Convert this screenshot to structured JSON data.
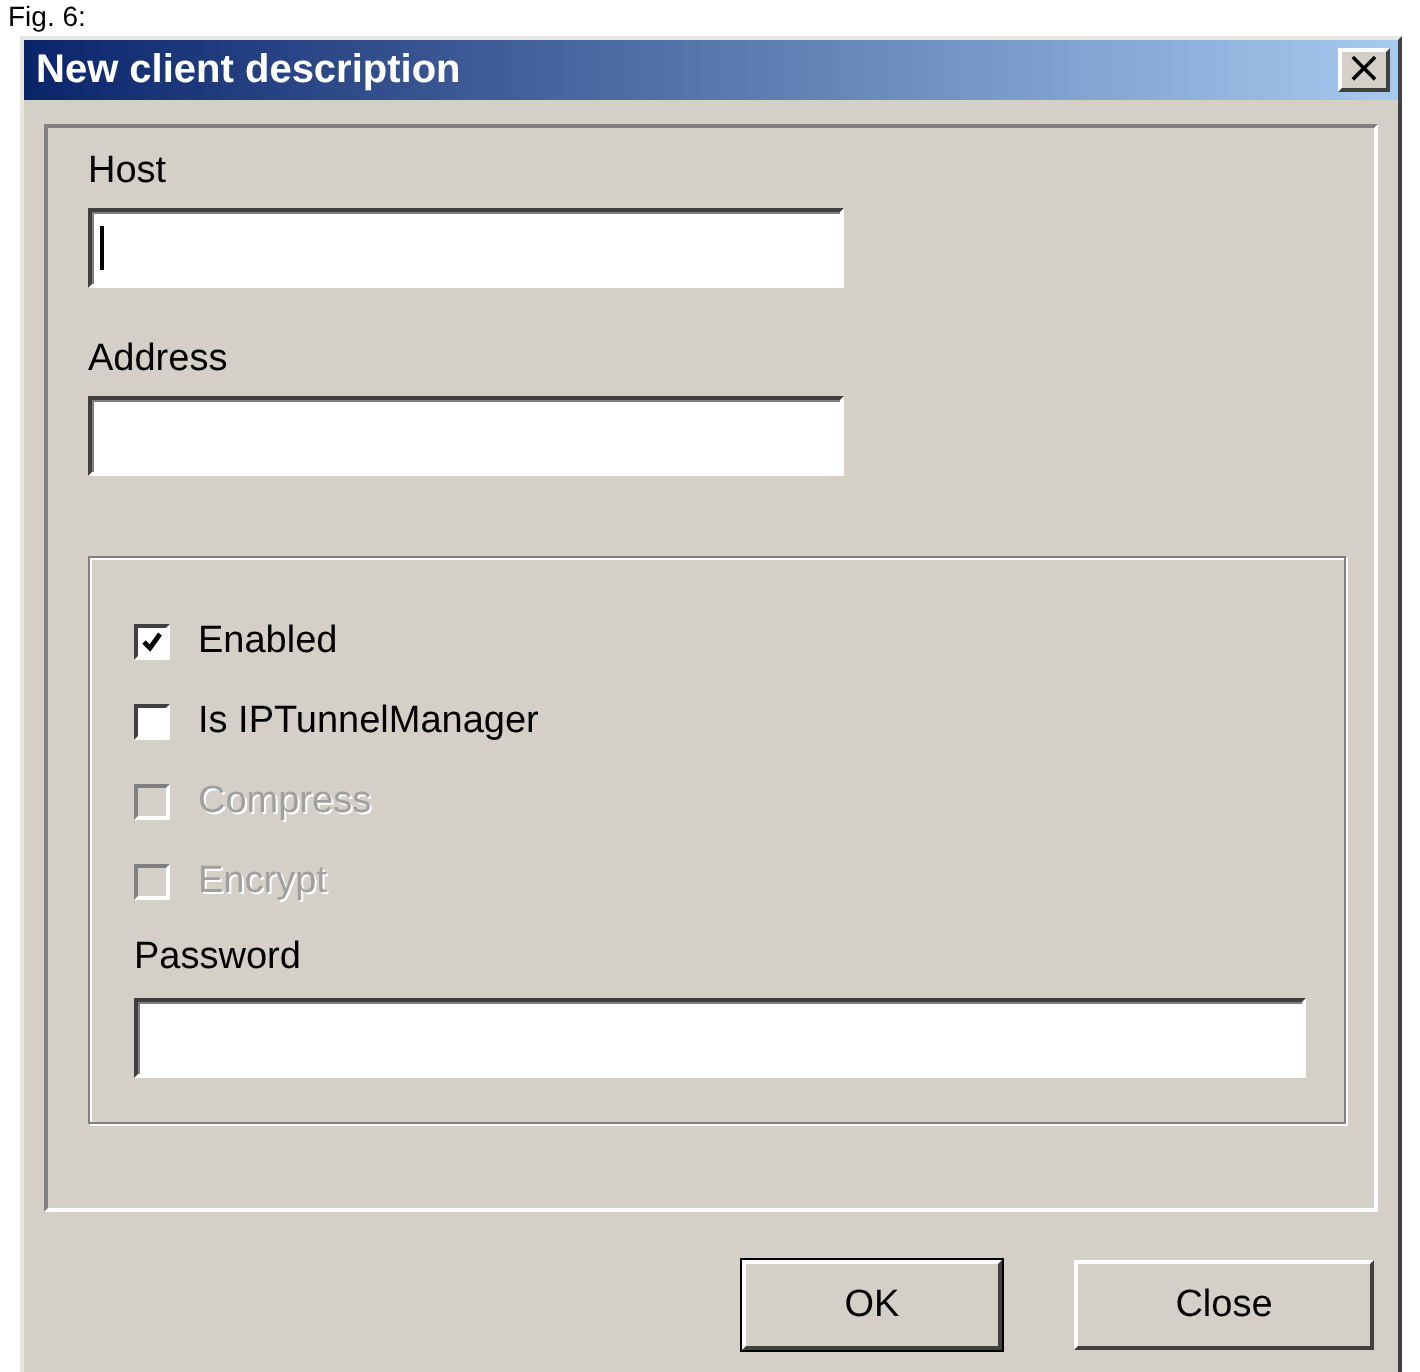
{
  "caption": "Fig. 6:",
  "window": {
    "title": "New client description",
    "close_glyph": "×"
  },
  "fields": [
    {
      "label": "Host",
      "focused": true
    },
    {
      "label": "Address",
      "focused": false
    }
  ],
  "options": [
    {
      "label": "Enabled",
      "checked": true,
      "disabled": false
    },
    {
      "label": "Is IPTunnelManager",
      "checked": false,
      "disabled": false
    },
    {
      "label": "Compress",
      "checked": false,
      "disabled": true
    },
    {
      "label": "Encrypt",
      "checked": false,
      "disabled": true
    }
  ],
  "password": {
    "label": "Password"
  },
  "buttons": [
    {
      "label": "OK",
      "default": true
    },
    {
      "label": "Close",
      "default": false
    }
  ]
}
